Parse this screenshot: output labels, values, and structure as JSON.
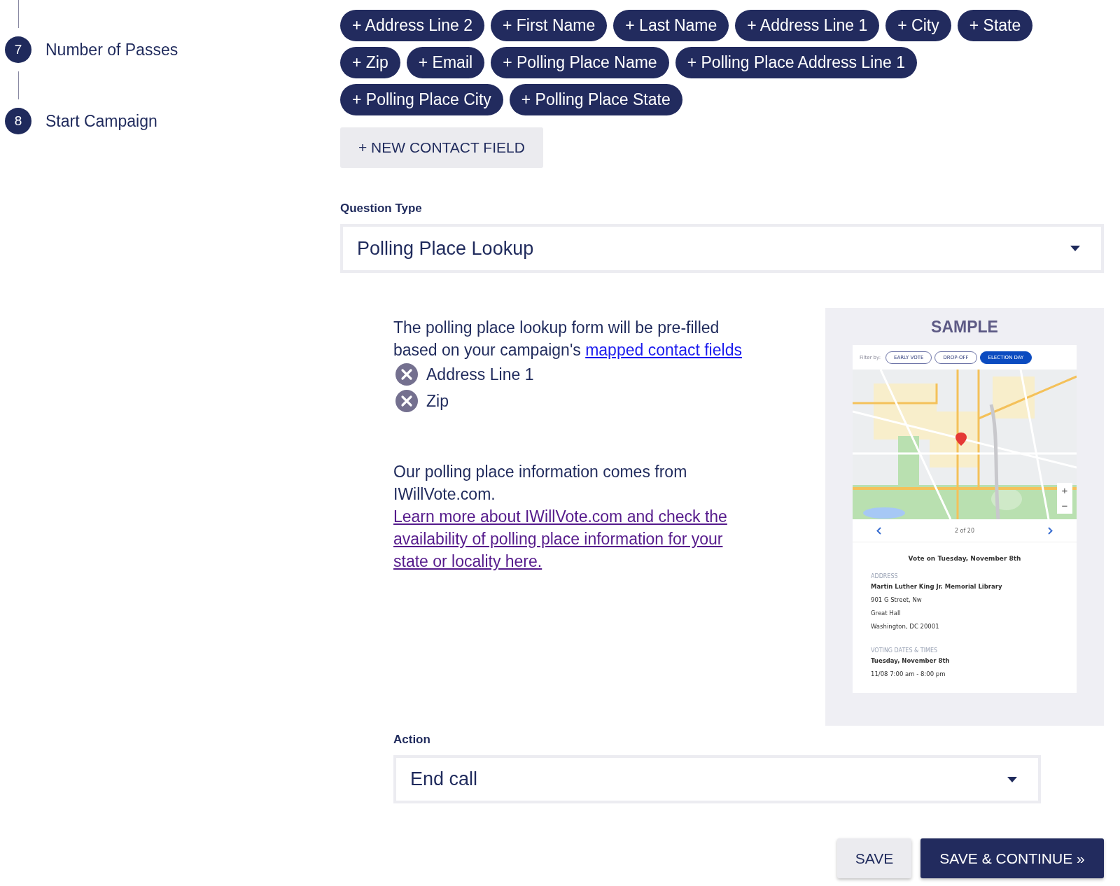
{
  "sidebar": {
    "steps": [
      {
        "number": "7",
        "label": "Number of Passes"
      },
      {
        "number": "8",
        "label": "Start Campaign"
      }
    ]
  },
  "contact_fields": [
    "+ Address Line 2",
    "+ First Name",
    "+ Last Name",
    "+ Address Line 1",
    "+ City",
    "+ State",
    "+ Zip",
    "+ Email",
    "+ Polling Place Name",
    "+ Polling Place Address Line 1",
    "+ Polling Place City",
    "+ Polling Place State"
  ],
  "new_contact_field_button": "+ NEW CONTACT FIELD",
  "question_type": {
    "label": "Question Type",
    "value": "Polling Place Lookup"
  },
  "description": {
    "text": "The polling place lookup form will be pre-filled based on your campaign's ",
    "link": "mapped contact fields"
  },
  "mapped_fields": [
    "Address Line 1",
    "Zip"
  ],
  "source_note": {
    "text": "Our polling place information comes from IWillVote.com. ",
    "link": "Learn more about IWillVote.com and check the availability of polling place information for your state or locality here."
  },
  "sample": {
    "title": "SAMPLE",
    "filter_label": "Filter by:",
    "filters": [
      {
        "label": "EARLY VOTE",
        "selected": false
      },
      {
        "label": "DROP-OFF",
        "selected": false
      },
      {
        "label": "ELECTION DAY",
        "selected": true
      }
    ],
    "zoom_in": "+",
    "zoom_out": "−",
    "pager": "2 of 20",
    "heading": "Vote on Tuesday, November 8th",
    "address_label": "ADDRESS",
    "address_lines": [
      "Martin Luther King Jr. Memorial Library",
      "901 G Street, Nw",
      "Great Hall",
      "Washington, DC 20001"
    ],
    "times_label": "VOTING DATES & TIMES",
    "times": [
      "Tuesday, November 8th",
      "11/08 7:00 am - 8:00 pm"
    ]
  },
  "action": {
    "label": "Action",
    "value": "End call"
  },
  "buttons": [
    {
      "label": "SAVE",
      "kind": "secondary"
    },
    {
      "label": "SAVE & CONTINUE »",
      "kind": "primary"
    }
  ]
}
